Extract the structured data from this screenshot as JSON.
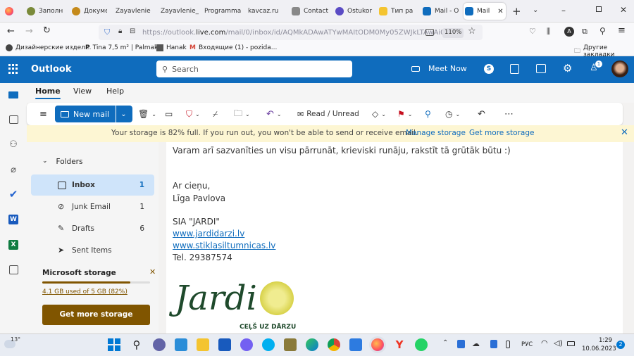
{
  "browser": {
    "tabs": [
      {
        "label": "Заполн",
        "color": "#7a8a3a"
      },
      {
        "label": "Докуме",
        "color": "#c58a1b"
      },
      {
        "label": "Zayavlenie",
        "color": "#ffffff"
      },
      {
        "label": "Zayavlenie_",
        "color": "#ffffff"
      },
      {
        "label": "Programma",
        "color": "#ffffff"
      },
      {
        "label": "kavcaz.ru",
        "color": "#ffffff"
      },
      {
        "label": "Contact",
        "color": "#888888"
      },
      {
        "label": "Ostukor",
        "color": "#5a4bc4"
      },
      {
        "label": "Тип ра",
        "color": "#f4c430"
      },
      {
        "label": "Mail - O",
        "color": "#0f6cbd"
      },
      {
        "label": "Mail",
        "color": "#0f6cbd"
      }
    ],
    "url_prefix": "https://outlook.",
    "url_domain": "live.com",
    "url_rest": "/mail/0/inbox/id/AQMkADAwATYwMAItODM0My05ZWJkLTAwAi0w",
    "zoom": "110%",
    "bookmarks": [
      {
        "label": "Дизайнерские издел..."
      },
      {
        "label": "Tina 7,5 m² | Palmako"
      },
      {
        "label": "Hanak"
      },
      {
        "label": "Входящие (1) - pozida..."
      }
    ],
    "other_bookmarks": "Другие закладки"
  },
  "outlook": {
    "app_name": "Outlook",
    "search_placeholder": "Search",
    "meet_now": "Meet Now",
    "notif_count": "1",
    "ribbon_tabs": [
      "Home",
      "View",
      "Help"
    ],
    "new_mail": "New mail",
    "read_unread": "Read / Unread",
    "banner_text": "Your storage is 82% full. If you run out, you won't be able to send or receive email.",
    "manage_storage": "Manage storage",
    "get_more_storage_link": "Get more storage",
    "folders_label": "Folders",
    "folders": [
      {
        "name": "Inbox",
        "count": "1"
      },
      {
        "name": "Junk Email",
        "count": "1"
      },
      {
        "name": "Drafts",
        "count": "6"
      },
      {
        "name": "Sent Items",
        "count": ""
      }
    ],
    "storage_title": "Microsoft storage",
    "storage_used": "4.1 GB used of 5 GB (82%)",
    "storage_fraction": 0.82,
    "storage_button": "Get more storage"
  },
  "message": {
    "line1": "Varam arī sazvanīties un visu pārrunāt, krieviski runāju, rakstīt tā grūtāk būtu :)",
    "greeting": "Ar cieņu,",
    "name": "Līga Pavlova",
    "company": "SIA \"JARDI\"",
    "site1": "www.jardidarzi.lv",
    "site2": "www.stiklasiltumnicas.lv",
    "tel": "Tel. 29387574",
    "logo_text": "Jardi",
    "logo_tagline": "CEĻŠ UZ DĀRZU"
  },
  "taskbar": {
    "temp": "13°",
    "lang": "РУС",
    "time": "1:29",
    "date": "10.06.2023",
    "notif": "2"
  }
}
